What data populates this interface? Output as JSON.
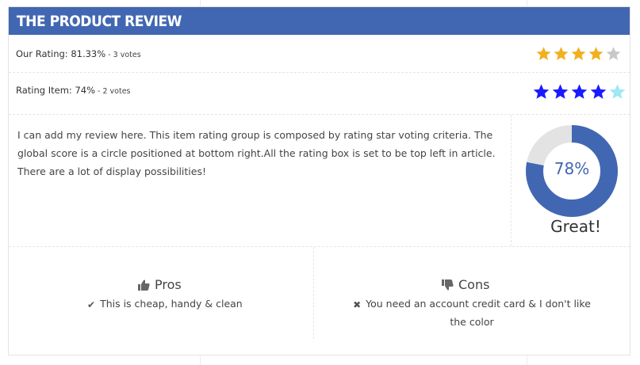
{
  "header": {
    "title": "THE PRODUCT REVIEW"
  },
  "ratings": [
    {
      "label": "Our Rating: 81.33%",
      "votes": " - 3 votes",
      "stars_filled": 4,
      "stars_total": 5,
      "value_percent": 81.33,
      "fill_color": "#f2b01e",
      "empty_color": "#c8c8c8"
    },
    {
      "label": "Rating Item: 74%",
      "votes": " - 2 votes",
      "stars_filled": 4,
      "stars_total": 5,
      "value_percent": 74,
      "fill_color": "#1a1aff",
      "empty_color": "#9fe8f5"
    }
  ],
  "description": "I can add my review here. This item rating group is composed by rating star voting criteria. The global score is a circle positioned at bottom right.All the rating box is set to be top left in article. There are a lot of display possibilities!",
  "score": {
    "value": "78%",
    "percent": 78,
    "verdict": "Great!",
    "ring_color": "#4267b2",
    "track_color": "#e3e3e3"
  },
  "pros": {
    "title": "Pros",
    "items": [
      "This is cheap, handy & clean"
    ]
  },
  "cons": {
    "title": "Cons",
    "items": [
      "You need an account credit card & I don't like the color"
    ]
  }
}
